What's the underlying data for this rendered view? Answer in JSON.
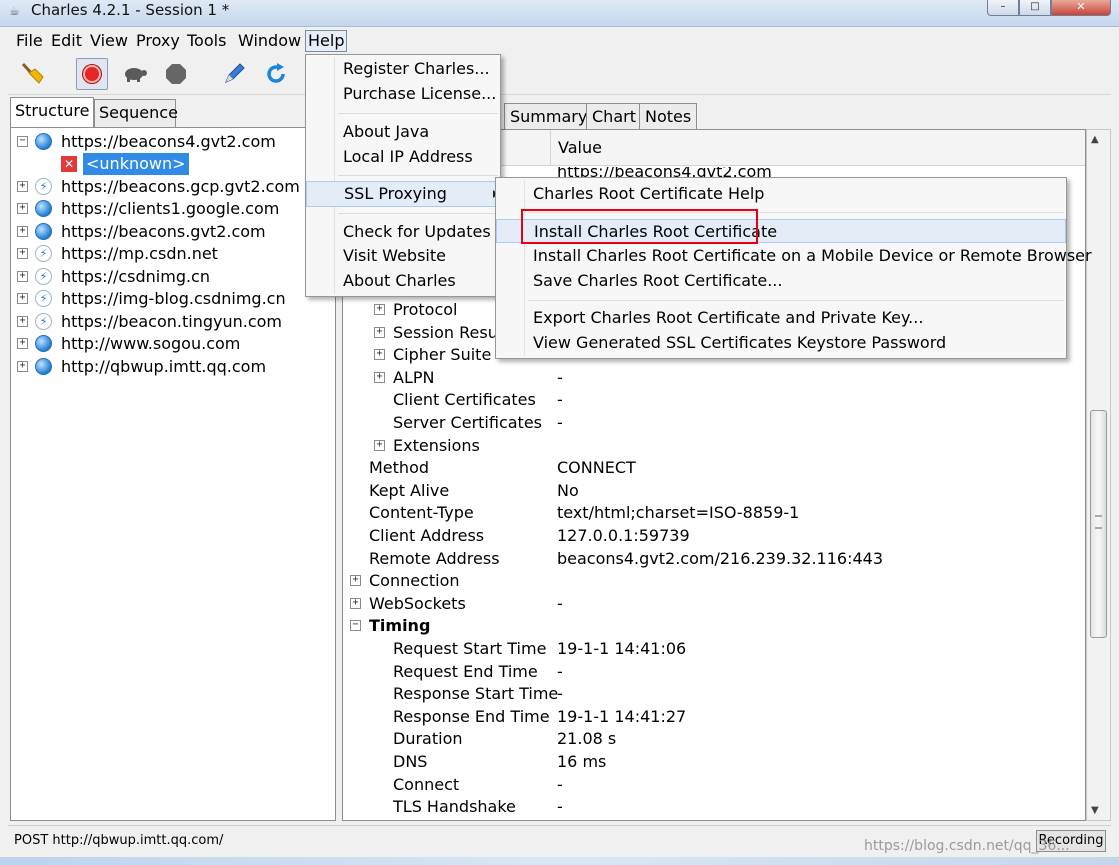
{
  "window": {
    "title": "Charles 4.2.1 - Session 1 *",
    "title_icon": "charles-teapot-icon",
    "minimize_glyph": "–",
    "maximize_glyph": "□",
    "close_glyph": "✕"
  },
  "menubar": [
    "File",
    "Edit",
    "View",
    "Proxy",
    "Tools",
    "Window",
    "Help"
  ],
  "toolbar": {
    "icons": [
      "broom-icon",
      "record-icon",
      "turtle-icon",
      "stop-icon",
      "pen-icon",
      "refresh-icon"
    ]
  },
  "left_panel": {
    "tabs": [
      "Structure",
      "Sequence"
    ],
    "tree": [
      {
        "host": "https://beacons4.gvt2.com",
        "icon": "globe-icon",
        "expanded": true
      },
      {
        "host": "<unknown>",
        "icon": "error-icon",
        "selected": true
      },
      {
        "host": "https://beacons.gcp.gvt2.com",
        "icon": "bolt-icon"
      },
      {
        "host": "https://clients1.google.com",
        "icon": "globe-icon"
      },
      {
        "host": "https://beacons.gvt2.com",
        "icon": "globe-icon"
      },
      {
        "host": "https://mp.csdn.net",
        "icon": "bolt-icon"
      },
      {
        "host": "https://csdnimg.cn",
        "icon": "bolt-icon"
      },
      {
        "host": "https://img-blog.csdnimg.cn",
        "icon": "bolt-icon"
      },
      {
        "host": "https://beacon.tingyun.com",
        "icon": "bolt-icon"
      },
      {
        "host": "http://www.sogou.com",
        "icon": "globe-icon"
      },
      {
        "host": "http://qbwup.imtt.qq.com",
        "icon": "globe-icon"
      }
    ]
  },
  "right_panel": {
    "tabs": [
      "Summary",
      "Chart",
      "Notes"
    ],
    "column_value": "Value",
    "partial_first_value": "https://beacons4.gvt2.com",
    "rows": [
      {
        "name": "Protocol",
        "value": "",
        "indent": 1,
        "toggle": true
      },
      {
        "name": "Session Resum",
        "value": "",
        "indent": 1,
        "toggle": true
      },
      {
        "name": "Cipher Suite",
        "value": "",
        "indent": 1,
        "toggle": true
      },
      {
        "name": "ALPN",
        "value": "-",
        "indent": 1,
        "toggle": true
      },
      {
        "name": "Client Certificates",
        "value": "-",
        "indent": 1
      },
      {
        "name": "Server Certificates",
        "value": "-",
        "indent": 1
      },
      {
        "name": "Extensions",
        "value": "",
        "indent": 1,
        "toggle": true
      },
      {
        "name": "Method",
        "value": "CONNECT",
        "indent": 0
      },
      {
        "name": "Kept Alive",
        "value": "No",
        "indent": 0
      },
      {
        "name": "Content-Type",
        "value": "text/html;charset=ISO-8859-1",
        "indent": 0
      },
      {
        "name": "Client Address",
        "value": "127.0.0.1:59739",
        "indent": 0
      },
      {
        "name": "Remote Address",
        "value": "beacons4.gvt2.com/216.239.32.116:443",
        "indent": 0
      },
      {
        "name": "Connection",
        "value": "",
        "indent": -1,
        "toggle": true
      },
      {
        "name": "WebSockets",
        "value": "-",
        "indent": -1,
        "toggle": true
      },
      {
        "name": "Timing",
        "value": "",
        "indent": -1,
        "toggle": true,
        "expanded": true,
        "bold": true
      },
      {
        "name": "Request Start Time",
        "value": "19-1-1 14:41:06",
        "indent": 1
      },
      {
        "name": "Request End Time",
        "value": "-",
        "indent": 1
      },
      {
        "name": "Response Start Time",
        "value": "-",
        "indent": 1
      },
      {
        "name": "Response End Time",
        "value": "19-1-1 14:41:27",
        "indent": 1
      },
      {
        "name": "Duration",
        "value": "21.08 s",
        "indent": 1
      },
      {
        "name": "DNS",
        "value": "16 ms",
        "indent": 1
      },
      {
        "name": "Connect",
        "value": "-",
        "indent": 1
      },
      {
        "name": "TLS Handshake",
        "value": "-",
        "indent": 1
      }
    ]
  },
  "help_menu": {
    "items": [
      {
        "label": "Register Charles...",
        "type": "item"
      },
      {
        "label": "Purchase License...",
        "type": "item"
      },
      {
        "type": "separator"
      },
      {
        "label": "About Java",
        "type": "item"
      },
      {
        "label": "Local IP Address",
        "type": "item"
      },
      {
        "type": "separator"
      },
      {
        "label": "SSL Proxying",
        "type": "submenu",
        "highlighted": true
      },
      {
        "type": "separator"
      },
      {
        "label": "Check for Updates",
        "type": "item"
      },
      {
        "label": "Visit Website",
        "type": "item"
      },
      {
        "label": "About Charles",
        "type": "item"
      }
    ]
  },
  "ssl_menu": {
    "items": [
      {
        "label": "Charles Root Certificate Help",
        "type": "item"
      },
      {
        "type": "separator"
      },
      {
        "label": "Install Charles Root Certificate",
        "type": "item",
        "highlighted": true
      },
      {
        "label": "Install Charles Root Certificate on a Mobile Device or Remote Browser",
        "type": "item"
      },
      {
        "label": "Save Charles Root Certificate...",
        "type": "item"
      },
      {
        "type": "separator"
      },
      {
        "label": "Export Charles Root Certificate and Private Key...",
        "type": "item"
      },
      {
        "label": "View Generated SSL Certificates Keystore Password",
        "type": "item"
      }
    ]
  },
  "status": {
    "text": "POST http://qbwup.imtt.qq.com/",
    "recording_label": "Recording"
  },
  "watermark": "https://blog.csdn.net/qq_36...",
  "colors": {
    "selection": "#2f8be6",
    "highlight_box": "#e60012",
    "record": "#e32626"
  }
}
